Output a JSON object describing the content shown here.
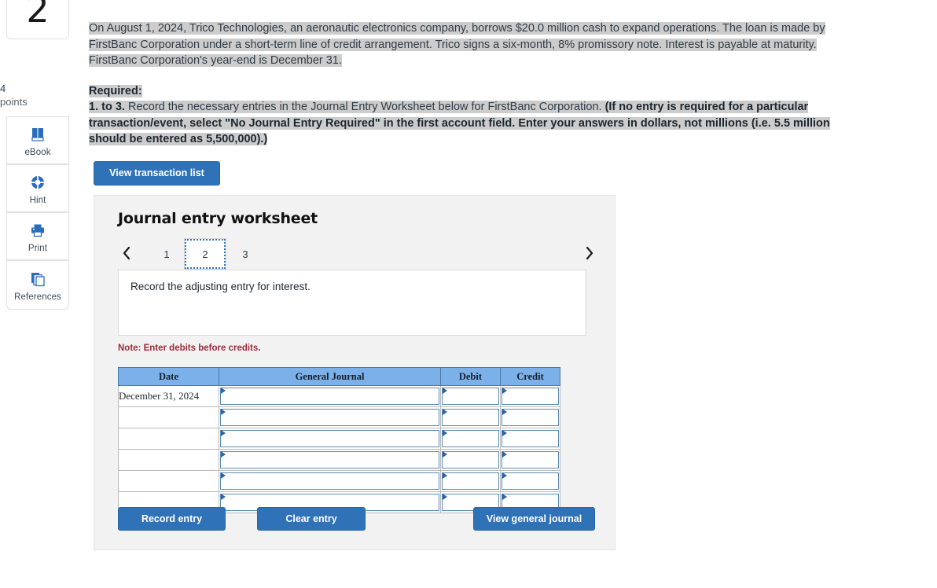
{
  "question": {
    "number": "2",
    "points_value": "4",
    "points_label": "points"
  },
  "tools": [
    {
      "label": "eBook",
      "icon": "book-icon"
    },
    {
      "label": "Hint",
      "icon": "lifebuoy-icon"
    },
    {
      "label": "Print",
      "icon": "printer-icon"
    },
    {
      "label": "References",
      "icon": "documents-icon"
    }
  ],
  "problem": {
    "paragraph": "On August 1, 2024, Trico Technologies, an aeronautic electronics company, borrows $20.0 million cash to expand operations. The loan is made by FirstBanc Corporation under a short-term line of credit arrangement. Trico signs a six-month, 8% promissory note. Interest is payable at maturity. FirstBanc Corporation's year-end is December 31.",
    "required_heading": "Required:",
    "required_prefix": "1. to 3.",
    "required_body": " Record the necessary entries in the Journal Entry Worksheet below for FirstBanc Corporation. ",
    "required_bold_tail": "(If no entry is required for a particular transaction/event, select \"No Journal Entry Required\" in the first account field. Enter your answers in dollars, not millions (i.e. 5.5 million should be entered as 5,500,000).)"
  },
  "toolbar": {
    "view_transaction_list_label": "View transaction list"
  },
  "worksheet": {
    "title": "Journal entry worksheet",
    "tabs": [
      {
        "label": "1",
        "selected": false
      },
      {
        "label": "2",
        "selected": true
      },
      {
        "label": "3",
        "selected": false
      }
    ],
    "prev_icon": "chevron-left-icon",
    "next_icon": "chevron-right-icon",
    "instruction": "Record the adjusting entry for interest.",
    "note": "Note: Enter debits before credits.",
    "table": {
      "headers": [
        "Date",
        "General Journal",
        "Debit",
        "Credit"
      ],
      "rows": [
        {
          "date": "December 31, 2024",
          "general_journal": "",
          "debit": "",
          "credit": ""
        },
        {
          "date": "",
          "general_journal": "",
          "debit": "",
          "credit": ""
        },
        {
          "date": "",
          "general_journal": "",
          "debit": "",
          "credit": ""
        },
        {
          "date": "",
          "general_journal": "",
          "debit": "",
          "credit": ""
        },
        {
          "date": "",
          "general_journal": "",
          "debit": "",
          "credit": ""
        },
        {
          "date": "",
          "general_journal": "",
          "debit": "",
          "credit": ""
        }
      ]
    },
    "buttons": {
      "record_entry": "Record entry",
      "clear_entry": "Clear entry",
      "view_general_journal": "View general journal"
    }
  },
  "colors": {
    "button_blue": "#3072b8",
    "table_header_blue": "#7bb0e8",
    "note_red": "#9c2b3b",
    "highlight_gray": "#cccccc",
    "panel_gray": "#f2f2f2",
    "icon_blue": "#2a6ebb"
  }
}
